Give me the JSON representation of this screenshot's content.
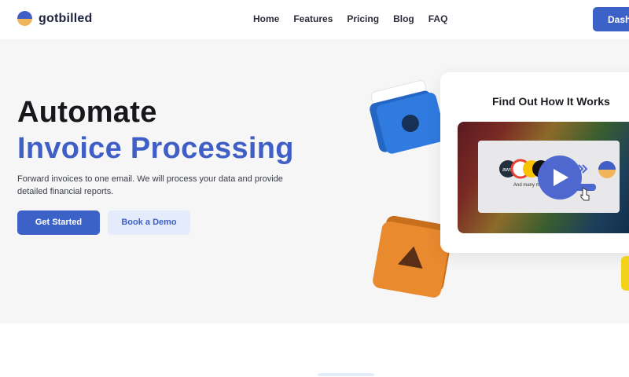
{
  "brand": {
    "name": "gotbilled"
  },
  "nav": {
    "items": [
      "Home",
      "Features",
      "Pricing",
      "Blog",
      "FAQ"
    ]
  },
  "header": {
    "dashboard_label": "Dash"
  },
  "hero": {
    "title_line1": "Automate",
    "title_line2": "Invoice Processing",
    "subtitle": "Forward invoices to one email. We will process your data and provide detailed financial reports.",
    "primary_cta": "Get Started",
    "secondary_cta": "Book a Demo"
  },
  "video_card": {
    "title": "Find Out How It Works",
    "inner_caption": "And many m",
    "logo_text": "aws"
  },
  "colors": {
    "accent": "#3f5fc6",
    "accent_light": "#e4ecfb",
    "hero_bg": "#f6f6f7",
    "folder_blue": "#2f7be0",
    "folder_orange": "#ea8a2f",
    "logo_orange": "#f0b45a"
  },
  "icons": [
    "logo-icon",
    "folder-blue-icon",
    "folder-orange-icon",
    "play-icon",
    "cursor-icon",
    "chevron-double-right-icon"
  ]
}
